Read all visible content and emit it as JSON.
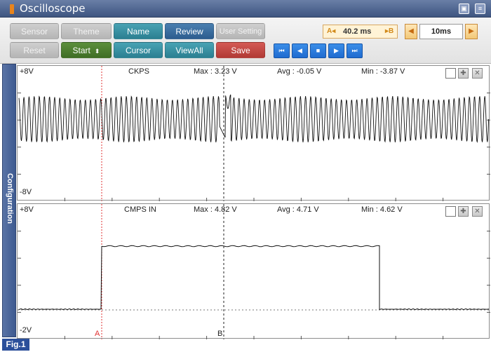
{
  "window": {
    "title": "Oscilloscope",
    "restore_icon": "restore-icon",
    "menu_icon": "menu-icon"
  },
  "toolbar": {
    "sensor_label": "Sensor",
    "theme_label": "Theme",
    "name_label": "Name",
    "review_label": "Review",
    "user_setting_label": "User Setting",
    "reset_label": "Reset",
    "start_label": "Start",
    "cursor_label": "Cursor",
    "viewall_label": "ViewAll",
    "save_label": "Save"
  },
  "cursor": {
    "a_mark": "A",
    "b_mark": "B",
    "delta": "40.2 ms"
  },
  "timebase": "10ms",
  "playback": [
    "first-icon",
    "back-icon",
    "stop-icon",
    "play-icon",
    "last-icon"
  ],
  "sidebar": {
    "label": "Configuration"
  },
  "channels": [
    {
      "name": "CKPS",
      "max": "Max : 3.23 V",
      "avg": "Avg : -0.05 V",
      "min": "Min : -3.87 V",
      "ymax": "+8V",
      "ymin": "-8V"
    },
    {
      "name": "CMPS IN",
      "max": "Max : 4.82 V",
      "avg": "Avg : 4.71 V",
      "min": "Min : 4.62 V",
      "ymax": "+8V",
      "ymin": "-2V"
    }
  ],
  "markers": {
    "a": "A",
    "b": "B"
  },
  "figure_label": "Fig.1",
  "colors": {
    "titlebar": "#4e6590",
    "trace": "#111111",
    "cursor_a": "#e03030",
    "cursor_b": "#222222",
    "playback": "#1f6bd0"
  }
}
